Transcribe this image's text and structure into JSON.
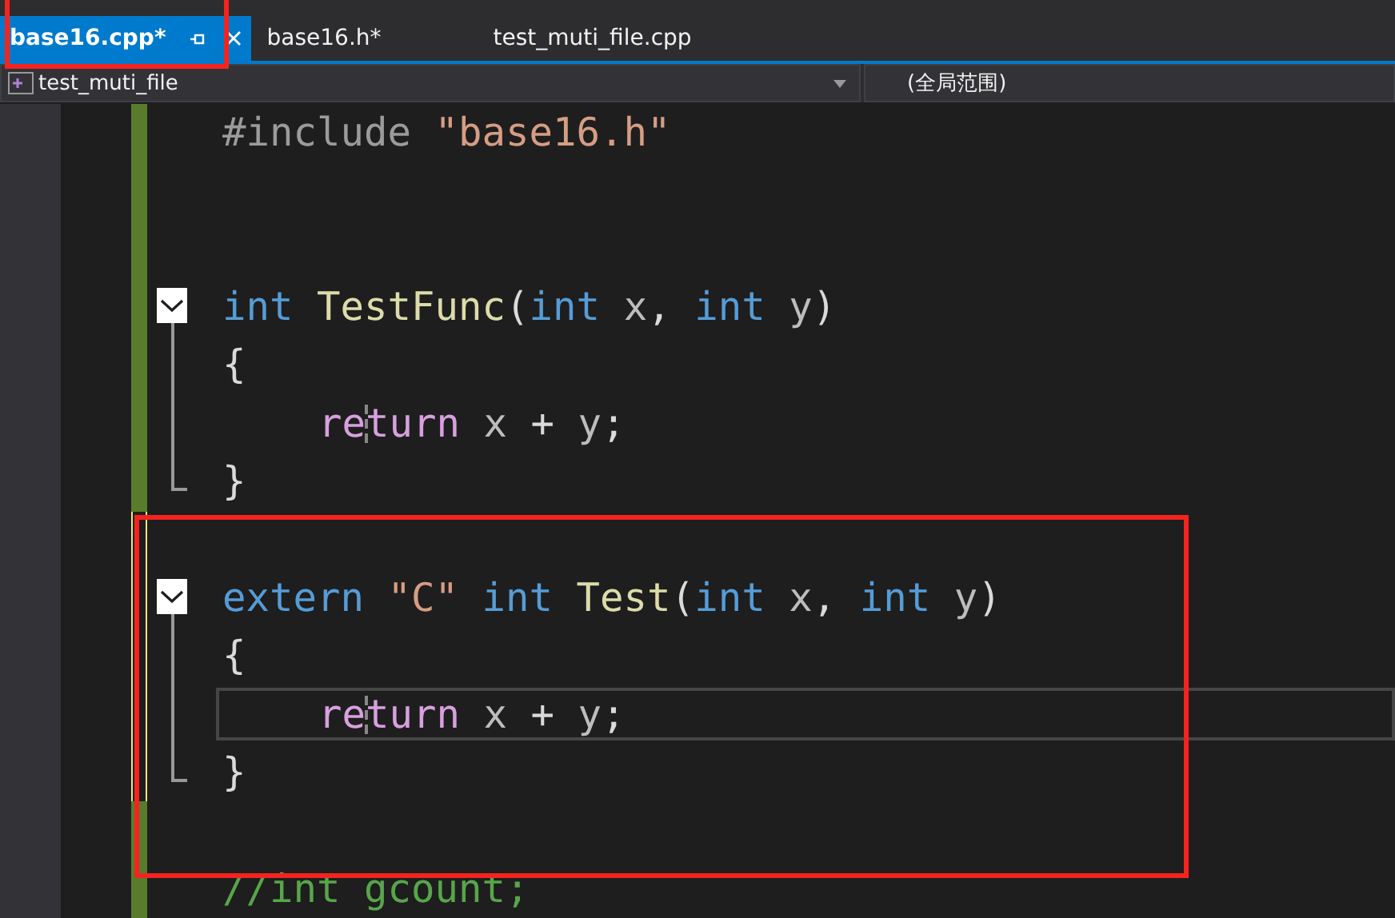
{
  "tabs": [
    {
      "label": "base16.cpp*",
      "selected": true
    },
    {
      "label": "base16.h*",
      "selected": false
    },
    {
      "label": "test_muti_file.cpp",
      "selected": false
    }
  ],
  "navigation": {
    "project": "test_muti_file",
    "scope": "(全局范围)"
  },
  "lines": [
    {
      "modified": false,
      "kind": "plain",
      "current": false,
      "tokens": [
        {
          "kind": "preproc",
          "text": "#include "
        },
        {
          "kind": "string",
          "text": "\"base16.h\""
        }
      ]
    },
    {
      "modified": false,
      "kind": "plain",
      "current": false
    },
    {
      "modified": false,
      "kind": "plain",
      "current": false
    },
    {
      "modified": false,
      "kind": "fold_start",
      "current": false,
      "tokens": [
        {
          "kind": "keyword",
          "text": "int "
        },
        {
          "kind": "function",
          "text": "TestFunc"
        },
        {
          "kind": "plain",
          "text": "("
        },
        {
          "kind": "keyword",
          "text": "int "
        },
        {
          "kind": "param",
          "text": "x"
        },
        {
          "kind": "plain",
          "text": ", "
        },
        {
          "kind": "keyword",
          "text": "int "
        },
        {
          "kind": "param",
          "text": "y"
        },
        {
          "kind": "plain",
          "text": ")"
        }
      ]
    },
    {
      "modified": false,
      "kind": "fold_brace",
      "current": false,
      "tokens": [
        {
          "kind": "plain",
          "text": "{"
        }
      ]
    },
    {
      "modified": false,
      "kind": "fold_body",
      "current": false,
      "tokens": [
        {
          "kind": "control",
          "text": "return "
        },
        {
          "kind": "param",
          "text": "x"
        },
        {
          "kind": "plain",
          "text": " + "
        },
        {
          "kind": "param",
          "text": "y"
        },
        {
          "kind": "plain",
          "text": ";"
        }
      ]
    },
    {
      "modified": false,
      "kind": "fold_end",
      "current": false,
      "tokens": [
        {
          "kind": "plain",
          "text": "}"
        }
      ]
    },
    {
      "modified": true,
      "kind": "plain",
      "current": false
    },
    {
      "modified": true,
      "kind": "fold_start",
      "current": false,
      "tokens": [
        {
          "kind": "keyword",
          "text": "extern "
        },
        {
          "kind": "string",
          "text": "\"C\""
        },
        {
          "kind": "keyword",
          "text": " int "
        },
        {
          "kind": "function",
          "text": "Test"
        },
        {
          "kind": "plain",
          "text": "("
        },
        {
          "kind": "keyword",
          "text": "int "
        },
        {
          "kind": "param",
          "text": "x"
        },
        {
          "kind": "plain",
          "text": ", "
        },
        {
          "kind": "keyword",
          "text": "int "
        },
        {
          "kind": "param",
          "text": "y"
        },
        {
          "kind": "plain",
          "text": ")"
        }
      ]
    },
    {
      "modified": true,
      "kind": "fold_brace",
      "current": false,
      "tokens": [
        {
          "kind": "plain",
          "text": "{"
        }
      ]
    },
    {
      "modified": true,
      "kind": "fold_body",
      "current": true,
      "tokens": [
        {
          "kind": "control",
          "text": "return "
        },
        {
          "kind": "param",
          "text": "x"
        },
        {
          "kind": "plain",
          "text": " + "
        },
        {
          "kind": "param",
          "text": "y"
        },
        {
          "kind": "plain",
          "text": ";"
        }
      ]
    },
    {
      "modified": true,
      "kind": "fold_end",
      "current": false,
      "tokens": [
        {
          "kind": "plain",
          "text": "}"
        }
      ]
    },
    {
      "modified": false,
      "kind": "plain",
      "current": false
    },
    {
      "modified": false,
      "kind": "plain",
      "current": false,
      "tokens": [
        {
          "kind": "comment",
          "text": "//int gcount;"
        }
      ]
    }
  ],
  "highlights": {
    "tab_area": true,
    "code_area": true
  }
}
